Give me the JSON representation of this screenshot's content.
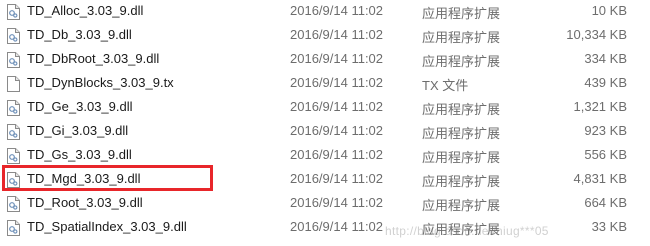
{
  "files": [
    {
      "name": "TD_Alloc_3.03_9.dll",
      "modified": "2016/9/14 11:02",
      "type": "应用程序扩展",
      "size": "10 KB",
      "icon": "dll-file-icon"
    },
    {
      "name": "TD_Db_3.03_9.dll",
      "modified": "2016/9/14 11:02",
      "type": "应用程序扩展",
      "size": "10,334 KB",
      "icon": "dll-file-icon"
    },
    {
      "name": "TD_DbRoot_3.03_9.dll",
      "modified": "2016/9/14 11:02",
      "type": "应用程序扩展",
      "size": "334 KB",
      "icon": "dll-file-icon"
    },
    {
      "name": "TD_DynBlocks_3.03_9.tx",
      "modified": "2016/9/14 11:02",
      "type": "TX 文件",
      "size": "439 KB",
      "icon": "generic-file-icon"
    },
    {
      "name": "TD_Ge_3.03_9.dll",
      "modified": "2016/9/14 11:02",
      "type": "应用程序扩展",
      "size": "1,321 KB",
      "icon": "dll-file-icon"
    },
    {
      "name": "TD_Gi_3.03_9.dll",
      "modified": "2016/9/14 11:02",
      "type": "应用程序扩展",
      "size": "923 KB",
      "icon": "dll-file-icon"
    },
    {
      "name": "TD_Gs_3.03_9.dll",
      "modified": "2016/9/14 11:02",
      "type": "应用程序扩展",
      "size": "556 KB",
      "icon": "dll-file-icon"
    },
    {
      "name": "TD_Mgd_3.03_9.dll",
      "modified": "2016/9/14 11:02",
      "type": "应用程序扩展",
      "size": "4,831 KB",
      "icon": "dll-file-icon"
    },
    {
      "name": "TD_Root_3.03_9.dll",
      "modified": "2016/9/14 11:02",
      "type": "应用程序扩展",
      "size": "664 KB",
      "icon": "dll-file-icon"
    },
    {
      "name": "TD_SpatialIndex_3.03_9.dll",
      "modified": "2016/9/14 11:02",
      "type": "应用程序扩展",
      "size": "33 KB",
      "icon": "dll-file-icon"
    }
  ],
  "highlight_color": "#e8262a",
  "watermark": "http://blog.csdn.net/niug***05"
}
